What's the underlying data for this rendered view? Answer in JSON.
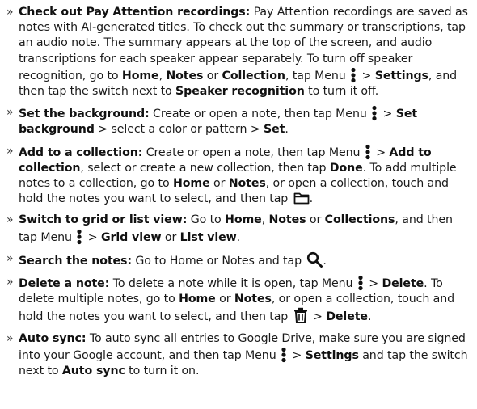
{
  "bullet_glyph": "»",
  "items": [
    {
      "segments": [
        {
          "t": "b",
          "v": "Check out Pay Attention recordings:"
        },
        {
          "t": "t",
          "v": " Pay Attention recordings are saved as notes with AI-generated titles. To check out the summary or transcriptions, tap an audio note. The summary appears at the top of the screen, and audio transcriptions for each speaker appear separately. To turn off speaker recognition, go to "
        },
        {
          "t": "b",
          "v": "Home"
        },
        {
          "t": "t",
          "v": ", "
        },
        {
          "t": "b",
          "v": "Notes"
        },
        {
          "t": "t",
          "v": " or "
        },
        {
          "t": "b",
          "v": "Collection"
        },
        {
          "t": "t",
          "v": ", tap Menu "
        },
        {
          "t": "icon",
          "v": "menu-dots-icon"
        },
        {
          "t": "t",
          "v": " > "
        },
        {
          "t": "b",
          "v": "Settings"
        },
        {
          "t": "t",
          "v": ", and then tap the switch next to "
        },
        {
          "t": "b",
          "v": "Speaker recognition"
        },
        {
          "t": "t",
          "v": " to turn it off."
        }
      ]
    },
    {
      "segments": [
        {
          "t": "b",
          "v": "Set the background:"
        },
        {
          "t": "t",
          "v": " Create or open a note, then tap Menu "
        },
        {
          "t": "icon",
          "v": "menu-dots-icon"
        },
        {
          "t": "t",
          "v": " > "
        },
        {
          "t": "b",
          "v": "Set background"
        },
        {
          "t": "t",
          "v": " > select a color or pattern > "
        },
        {
          "t": "b",
          "v": "Set"
        },
        {
          "t": "t",
          "v": "."
        }
      ]
    },
    {
      "segments": [
        {
          "t": "b",
          "v": "Add to a collection:"
        },
        {
          "t": "t",
          "v": " Create or open a note, then tap Menu "
        },
        {
          "t": "icon",
          "v": "menu-dots-icon"
        },
        {
          "t": "t",
          "v": " > "
        },
        {
          "t": "b",
          "v": "Add to collection"
        },
        {
          "t": "t",
          "v": ", select or create a new collection, then tap "
        },
        {
          "t": "b",
          "v": "Done"
        },
        {
          "t": "t",
          "v": ". To add multiple notes to a collection, go to "
        },
        {
          "t": "b",
          "v": "Home"
        },
        {
          "t": "t",
          "v": " or "
        },
        {
          "t": "b",
          "v": "Notes"
        },
        {
          "t": "t",
          "v": ", or open a collection, touch and hold the notes you want to select, and then tap "
        },
        {
          "t": "icon",
          "v": "folder-icon"
        },
        {
          "t": "t",
          "v": "."
        }
      ]
    },
    {
      "segments": [
        {
          "t": "b",
          "v": "Switch to grid or list view:"
        },
        {
          "t": "t",
          "v": " Go to "
        },
        {
          "t": "b",
          "v": "Home"
        },
        {
          "t": "t",
          "v": ", "
        },
        {
          "t": "b",
          "v": "Notes"
        },
        {
          "t": "t",
          "v": " or "
        },
        {
          "t": "b",
          "v": "Collections"
        },
        {
          "t": "t",
          "v": ", and then tap Menu "
        },
        {
          "t": "icon",
          "v": "menu-dots-icon"
        },
        {
          "t": "t",
          "v": " > "
        },
        {
          "t": "b",
          "v": "Grid view"
        },
        {
          "t": "t",
          "v": " or "
        },
        {
          "t": "b",
          "v": "List view"
        },
        {
          "t": "t",
          "v": "."
        }
      ]
    },
    {
      "segments": [
        {
          "t": "b",
          "v": "Search the notes:"
        },
        {
          "t": "t",
          "v": " Go to Home or Notes and tap "
        },
        {
          "t": "icon",
          "v": "search-icon"
        },
        {
          "t": "t",
          "v": "."
        }
      ]
    },
    {
      "segments": [
        {
          "t": "b",
          "v": "Delete a note:"
        },
        {
          "t": "t",
          "v": " To delete a note while it is open, tap Menu "
        },
        {
          "t": "icon",
          "v": "menu-dots-icon"
        },
        {
          "t": "t",
          "v": " > "
        },
        {
          "t": "b",
          "v": "Delete"
        },
        {
          "t": "t",
          "v": ". To delete multiple notes, go to "
        },
        {
          "t": "b",
          "v": "Home"
        },
        {
          "t": "t",
          "v": " or "
        },
        {
          "t": "b",
          "v": "Notes"
        },
        {
          "t": "t",
          "v": ", or open a collection, touch and hold the notes you want to select, and then tap "
        },
        {
          "t": "icon",
          "v": "trash-icon"
        },
        {
          "t": "t",
          "v": " > "
        },
        {
          "t": "b",
          "v": "Delete"
        },
        {
          "t": "t",
          "v": "."
        }
      ]
    },
    {
      "segments": [
        {
          "t": "b",
          "v": "Auto sync:"
        },
        {
          "t": "t",
          "v": " To auto sync all entries to Google Drive, make sure you are signed into your Google account, and then tap Menu "
        },
        {
          "t": "icon",
          "v": "menu-dots-icon"
        },
        {
          "t": "t",
          "v": " > "
        },
        {
          "t": "b",
          "v": "Settings"
        },
        {
          "t": "t",
          "v": " and tap the switch next to "
        },
        {
          "t": "b",
          "v": "Auto sync"
        },
        {
          "t": "t",
          "v": " to turn it on."
        }
      ]
    }
  ]
}
